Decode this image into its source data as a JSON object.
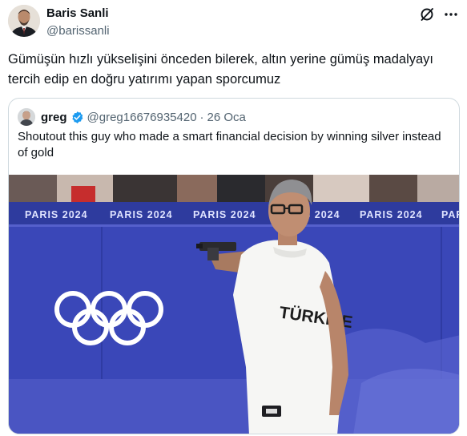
{
  "author": {
    "name": "Baris Sanli",
    "handle": "@barissanli"
  },
  "icons": [
    "grok-icon",
    "more-icon",
    "verified-badge-icon"
  ],
  "tweet": {
    "text": "Gümüşün hızlı yükselişini önceden bilerek, altın yerine gümüş madalyayı tercih edip en doğru yatırımı yapan sporcumuz"
  },
  "quoted": {
    "name": "greg",
    "handle": "@greg16676935420",
    "separator": "·",
    "date": "26 Oca",
    "text": "Shoutout this guy who made a smart financial decision by winning silver instead of gold",
    "image": {
      "banner_texts": [
        "PARIS 2024",
        "PARIS 2024",
        "PARIS 2024",
        "PARIS 2024",
        "PARIS 2024",
        "PARIS 2024",
        "PA"
      ],
      "shirt_text": "TÜRKİYE",
      "colors": {
        "wall": "#3a47b8",
        "banner": "#2e3b9e",
        "olympic_rings": "#ffffff",
        "floor": "#4a55c2"
      }
    }
  },
  "colors": {
    "verified": "#1d9bf0",
    "secondary_text": "#536471",
    "border": "#cfd9de"
  }
}
